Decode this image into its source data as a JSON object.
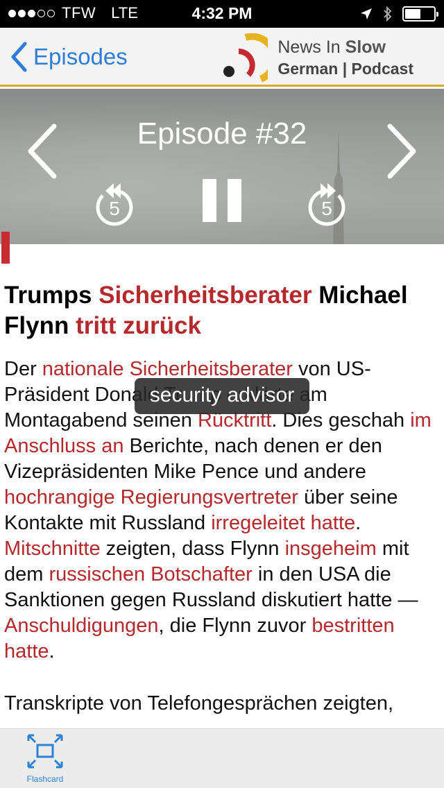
{
  "status_bar": {
    "carrier": "TFW",
    "network": "LTE",
    "time": "4:32 PM",
    "signal_bars_filled": 3,
    "signal_bars_total": 5,
    "battery_level": 0.45
  },
  "nav": {
    "back_label": "Episodes",
    "brand_line1_prefix": "News In ",
    "brand_line1_emph": "Slow",
    "brand_line2": "German | Podcast"
  },
  "player": {
    "episode_title": "Episode #32",
    "skip_back_seconds": "5",
    "skip_forward_seconds": "5"
  },
  "article": {
    "headline": [
      {
        "t": "Trumps ",
        "hl": false
      },
      {
        "t": "Sicherheitsberater",
        "hl": true
      },
      {
        "t": " Michael Flynn ",
        "hl": false
      },
      {
        "t": "tritt zurück",
        "hl": true
      }
    ],
    "paragraph1": [
      {
        "t": "Der ",
        "hl": false
      },
      {
        "t": "nationale Sicherheitsberater",
        "hl": true
      },
      {
        "t": " von US-Präsident Donald Trump erklärte am Montagabend seinen ",
        "hl": false
      },
      {
        "t": "Rücktritt",
        "hl": true
      },
      {
        "t": ". Dies geschah ",
        "hl": false
      },
      {
        "t": "im Anschluss an",
        "hl": true
      },
      {
        "t": " Berichte, nach denen er den Vizepräsidenten Mike Pence und andere ",
        "hl": false
      },
      {
        "t": "hochrangige Regierungsvertreter",
        "hl": true
      },
      {
        "t": " über seine Kontakte mit Russland ",
        "hl": false
      },
      {
        "t": "irregeleitet hatte",
        "hl": true
      },
      {
        "t": ". ",
        "hl": false
      },
      {
        "t": "Mitschnitte",
        "hl": true
      },
      {
        "t": " zeigten, dass Flynn ",
        "hl": false
      },
      {
        "t": "insgeheim",
        "hl": true
      },
      {
        "t": " mit dem ",
        "hl": false
      },
      {
        "t": "russischen Botschafter",
        "hl": true
      },
      {
        "t": " in den USA die Sanktionen gegen Russland diskutiert hatte — ",
        "hl": false
      },
      {
        "t": "Anschuldigungen",
        "hl": true
      },
      {
        "t": ", die Flynn zuvor ",
        "hl": false
      },
      {
        "t": "bestritten hatte",
        "hl": true
      },
      {
        "t": ".",
        "hl": false
      }
    ],
    "paragraph2": "Transkripte von Telefongesprächen zeigten,"
  },
  "tooltip": {
    "text": "security advisor"
  },
  "bottom_bar": {
    "flashcard_label": "Flashcard"
  },
  "colors": {
    "accent_red": "#b5282c",
    "nav_blue": "#2f7bd8",
    "brand_gold": "#d9a92a"
  }
}
